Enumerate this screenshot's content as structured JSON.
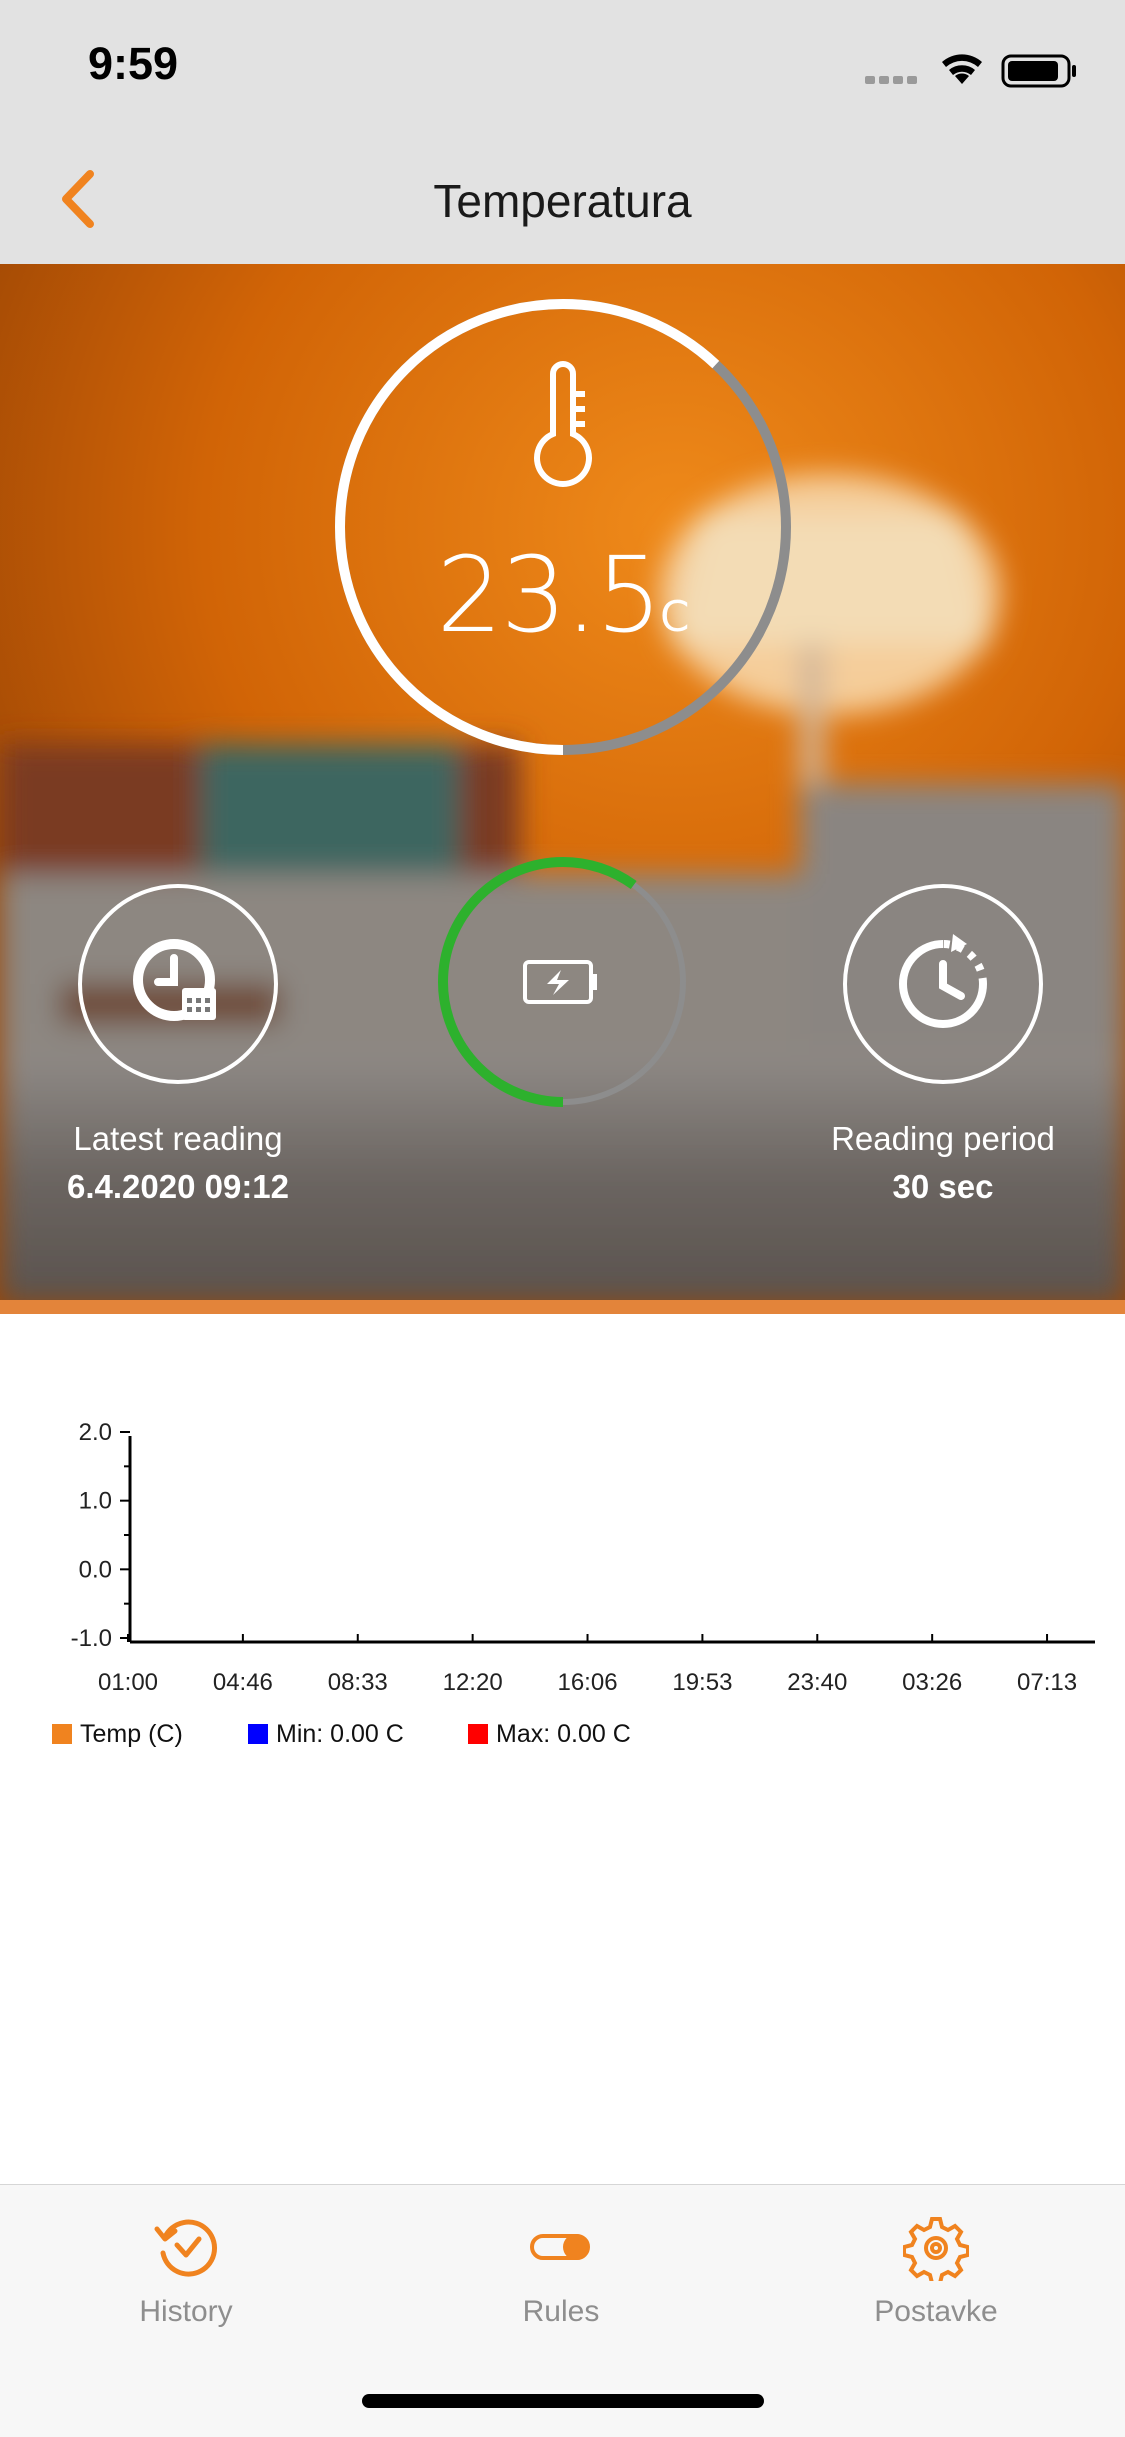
{
  "status_bar": {
    "time": "9:59"
  },
  "nav": {
    "title": "Temperatura",
    "back_icon": "chevron-left-icon"
  },
  "colors": {
    "accent": "#f0831f",
    "battery": "#2db12d",
    "hero_bg": "#d66808"
  },
  "gauge": {
    "value": "23.5",
    "unit": "C",
    "icon": "thermometer-icon",
    "fill_fraction": 0.62
  },
  "battery": {
    "icon": "battery-charging-icon",
    "level_fraction": 0.6
  },
  "latest_reading": {
    "icon": "clock-calendar-icon",
    "label": "Latest reading",
    "value": "6.4.2020 09:12"
  },
  "reading_period": {
    "icon": "clock-refresh-icon",
    "label": "Reading period",
    "value": "30 sec"
  },
  "chart_data": {
    "type": "line",
    "x_ticks": [
      "01:00",
      "04:46",
      "08:33",
      "12:20",
      "16:06",
      "19:53",
      "23:40",
      "03:26",
      "07:13"
    ],
    "y_ticks": [
      "2.0",
      "1.0",
      "0.0",
      "-1.0"
    ],
    "ylim": [
      -1.0,
      2.0
    ],
    "series": [
      {
        "name": "Temp (C)",
        "color": "#f0831f",
        "values": []
      },
      {
        "name": "Min: 0.00 C",
        "color": "#0000ff",
        "values": []
      },
      {
        "name": "Max: 0.00 C",
        "color": "#ff0000",
        "values": []
      }
    ]
  },
  "tabs": [
    {
      "label": "History",
      "icon": "history-clock-icon"
    },
    {
      "label": "Rules",
      "icon": "toggle-icon"
    },
    {
      "label": "Postavke",
      "icon": "gear-icon"
    }
  ]
}
